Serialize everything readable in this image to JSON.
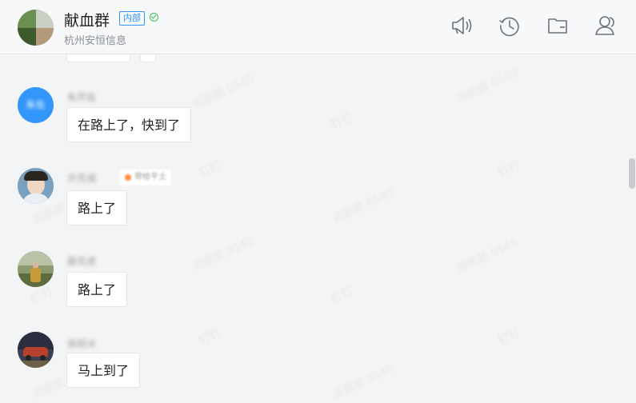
{
  "header": {
    "group_name": "献血群",
    "badge": "内部",
    "org_name": "杭州安恒信息",
    "tools": [
      {
        "name": "announcement-icon"
      },
      {
        "name": "history-icon"
      },
      {
        "name": "folder-icon"
      },
      {
        "name": "members-icon"
      }
    ]
  },
  "watermark": {
    "text_app": "钉钉",
    "text_user": "周鹏鹏 0540"
  },
  "messages": [
    {
      "sender": "朱芹佐",
      "text": "在路上了，快到了",
      "avatar_color": "#3296fa",
      "avatar_text": "朱佐"
    },
    {
      "sender": "许克诚",
      "tag": "带给平土",
      "text": "路上了",
      "avatar_color": "#7aa0c0"
    },
    {
      "sender": "薛克虎",
      "text": "路上了",
      "avatar_color": "#8c9a70"
    },
    {
      "sender": "张昭冰",
      "text": "马上到了",
      "avatar_color": "#3a3f52"
    }
  ]
}
